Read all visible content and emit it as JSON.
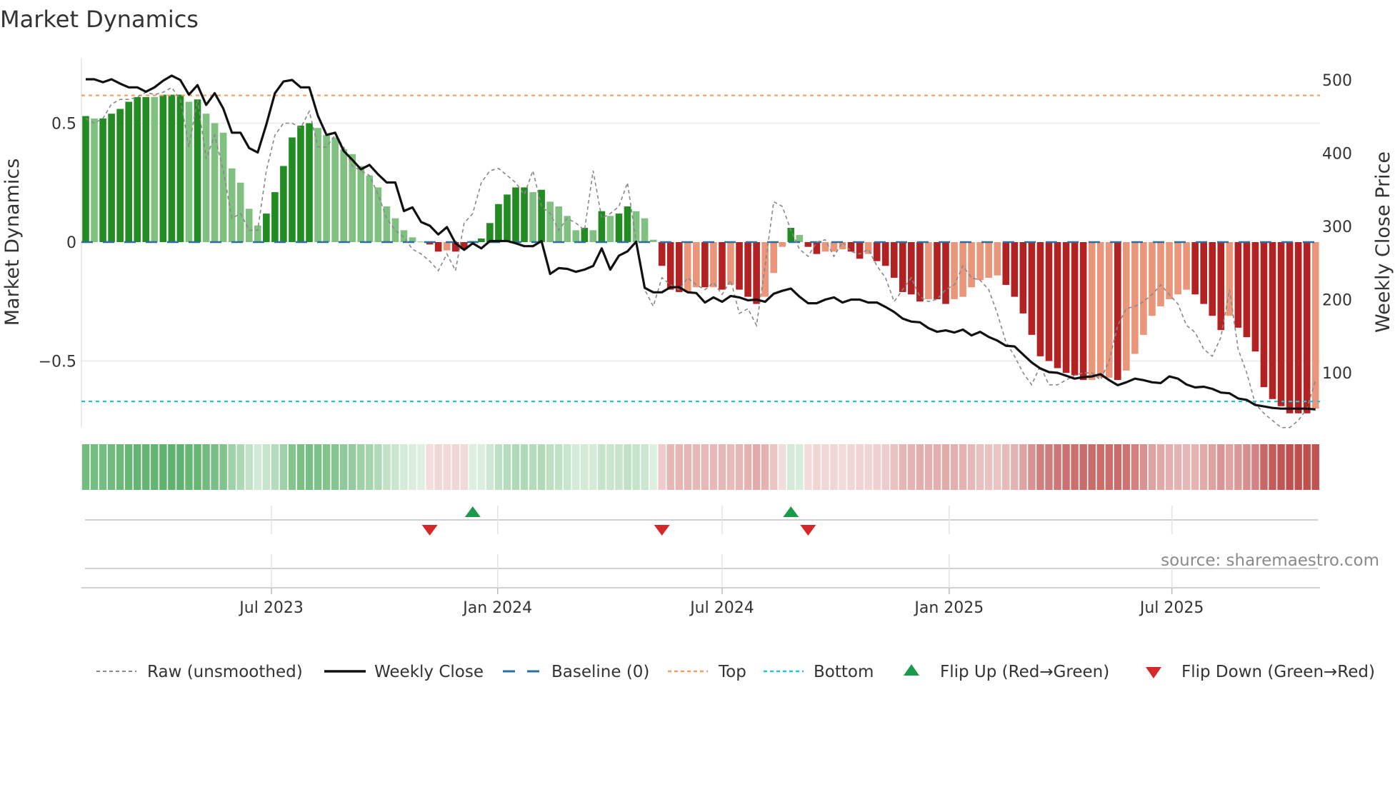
{
  "title": "Market Dynamics",
  "source": "source: sharemaestro.com",
  "chart_data": {
    "type": "bar",
    "title": "Market Dynamics",
    "xlabel": "",
    "ylabel": "Market Dynamics",
    "y2label": "Weekly Close Price",
    "ylim": [
      -0.778,
      0.775
    ],
    "y2lim": [
      26,
      530
    ],
    "y_ticks": [
      {
        "v": 0.5,
        "label": "0.5"
      },
      {
        "v": 0,
        "label": "0"
      },
      {
        "v": -0.5,
        "label": "−0.5"
      }
    ],
    "y2_ticks": [
      {
        "v": 500,
        "label": "500"
      },
      {
        "v": 400,
        "label": "400"
      },
      {
        "v": 300,
        "label": "300"
      },
      {
        "v": 200,
        "label": "200"
      },
      {
        "v": 100,
        "label": "100"
      }
    ],
    "x_unit": "week index (weekly bars)",
    "x_ticks": [
      {
        "week": 21.6,
        "label": "Jul 2023"
      },
      {
        "week": 47.9,
        "label": "Jan 2024"
      },
      {
        "week": 74.0,
        "label": "Jul 2024"
      },
      {
        "week": 100.4,
        "label": "Jan 2025"
      },
      {
        "week": 126.3,
        "label": "Jul 2025"
      }
    ],
    "grid": true,
    "legend_placement": "bottom",
    "thresholds": {
      "top": 0.617,
      "bottom": -0.67,
      "baseline": 0
    },
    "momentum": [
      0.53,
      0.52,
      0.52,
      0.54,
      0.56,
      0.59,
      0.61,
      0.61,
      0.61,
      0.62,
      0.62,
      0.62,
      0.59,
      0.6,
      0.54,
      0.5,
      0.46,
      0.31,
      0.25,
      0.14,
      0.07,
      0.12,
      0.21,
      0.32,
      0.44,
      0.49,
      0.5,
      0.48,
      0.45,
      0.44,
      0.39,
      0.37,
      0.32,
      0.28,
      0.23,
      0.15,
      0.1,
      0.05,
      0.02,
      0.002,
      -0.01,
      -0.04,
      -0.035,
      -0.04,
      -0.03,
      0.005,
      0.015,
      0.08,
      0.16,
      0.2,
      0.23,
      0.23,
      0.21,
      0.22,
      0.17,
      0.15,
      0.11,
      0.05,
      0.06,
      0.05,
      0.13,
      0.11,
      0.12,
      0.15,
      0.13,
      0.1,
      0.01,
      -0.1,
      -0.2,
      -0.21,
      -0.21,
      -0.19,
      -0.19,
      -0.19,
      -0.2,
      -0.18,
      -0.2,
      -0.23,
      -0.26,
      -0.23,
      -0.13,
      -0.02,
      0.06,
      0.03,
      -0.02,
      -0.05,
      -0.04,
      -0.04,
      -0.03,
      -0.04,
      -0.07,
      -0.05,
      -0.08,
      -0.1,
      -0.15,
      -0.21,
      -0.22,
      -0.25,
      -0.24,
      -0.24,
      -0.26,
      -0.24,
      -0.23,
      -0.19,
      -0.16,
      -0.15,
      -0.14,
      -0.18,
      -0.23,
      -0.3,
      -0.39,
      -0.48,
      -0.5,
      -0.53,
      -0.55,
      -0.56,
      -0.58,
      -0.58,
      -0.57,
      -0.57,
      -0.58,
      -0.54,
      -0.47,
      -0.39,
      -0.31,
      -0.27,
      -0.24,
      -0.22,
      -0.2,
      -0.22,
      -0.26,
      -0.31,
      -0.37,
      -0.31,
      -0.36,
      -0.4,
      -0.46,
      -0.61,
      -0.66,
      -0.69,
      -0.72,
      -0.72,
      -0.72,
      -0.7
    ],
    "strong": [
      1,
      0,
      1,
      1,
      1,
      1,
      1,
      1,
      0,
      1,
      1,
      1,
      0,
      1,
      0,
      0,
      0,
      0,
      0,
      0,
      0,
      1,
      1,
      1,
      1,
      1,
      1,
      0,
      0,
      0,
      0,
      0,
      0,
      0,
      0,
      0,
      0,
      0,
      0,
      0,
      1,
      1,
      0,
      1,
      1,
      0,
      1,
      1,
      1,
      1,
      1,
      1,
      0,
      1,
      0,
      0,
      0,
      0,
      1,
      0,
      1,
      0,
      1,
      1,
      0,
      0,
      0,
      1,
      1,
      1,
      0,
      0,
      1,
      0,
      1,
      0,
      1,
      1,
      1,
      0,
      0,
      0,
      1,
      0,
      1,
      1,
      0,
      0,
      0,
      1,
      1,
      0,
      1,
      1,
      1,
      1,
      1,
      1,
      0,
      1,
      1,
      0,
      0,
      0,
      0,
      0,
      0,
      1,
      1,
      1,
      1,
      1,
      1,
      1,
      1,
      1,
      1,
      0,
      0,
      0,
      1,
      0,
      0,
      0,
      0,
      0,
      0,
      0,
      0,
      1,
      1,
      1,
      1,
      0,
      1,
      1,
      1,
      1,
      1,
      1,
      1,
      1,
      1,
      0
    ],
    "raw": [
      0.52,
      0.5,
      0.52,
      0.58,
      0.6,
      0.6,
      0.61,
      0.63,
      0.62,
      0.63,
      0.65,
      0.6,
      0.4,
      0.6,
      0.35,
      0.45,
      0.3,
      0.1,
      0.12,
      0.05,
      0.05,
      0.3,
      0.45,
      0.5,
      0.5,
      0.48,
      0.55,
      0.4,
      0.4,
      0.45,
      0.4,
      0.32,
      0.3,
      0.28,
      0.2,
      0.1,
      0.05,
      0.02,
      -0.03,
      -0.05,
      -0.08,
      -0.12,
      -0.05,
      -0.12,
      0.08,
      0.12,
      0.25,
      0.3,
      0.31,
      0.28,
      0.25,
      0.2,
      0.3,
      0.15,
      0.12,
      0.05,
      0.1,
      0.08,
      0.05,
      0.3,
      0.1,
      0.12,
      0.15,
      0.25,
      0.0,
      -0.2,
      -0.27,
      -0.15,
      -0.18,
      -0.2,
      -0.15,
      -0.18,
      -0.2,
      -0.17,
      -0.22,
      -0.16,
      -0.3,
      -0.28,
      -0.35,
      -0.1,
      0.17,
      0.15,
      0.05,
      -0.03,
      -0.06,
      0.0,
      0.01,
      -0.06,
      0.0,
      -0.04,
      -0.05,
      -0.03,
      -0.1,
      -0.15,
      -0.25,
      -0.2,
      -0.15,
      -0.23,
      -0.25,
      -0.24,
      -0.2,
      -0.18,
      -0.1,
      -0.15,
      -0.16,
      -0.2,
      -0.3,
      -0.42,
      -0.48,
      -0.55,
      -0.6,
      -0.52,
      -0.6,
      -0.6,
      -0.58,
      -0.56,
      -0.55,
      -0.55,
      -0.58,
      -0.5,
      -0.35,
      -0.28,
      -0.27,
      -0.25,
      -0.22,
      -0.18,
      -0.22,
      -0.26,
      -0.35,
      -0.38,
      -0.45,
      -0.48,
      -0.4,
      -0.2,
      -0.45,
      -0.55,
      -0.68,
      -0.72,
      -0.75,
      -0.78,
      -0.78,
      -0.75,
      -0.7,
      -0.58
    ],
    "close": [
      501,
      501,
      497,
      501,
      495,
      490,
      490,
      484,
      490,
      499,
      506,
      500,
      480,
      493,
      466,
      482,
      461,
      428,
      428,
      407,
      401,
      439,
      482,
      498,
      500,
      490,
      490,
      451,
      425,
      428,
      403,
      391,
      378,
      384,
      371,
      360,
      360,
      321,
      326,
      306,
      301,
      289,
      299,
      277,
      268,
      277,
      270,
      280,
      280,
      280,
      277,
      273,
      273,
      280,
      235,
      243,
      242,
      238,
      241,
      246,
      270,
      241,
      260,
      266,
      279,
      216,
      210,
      210,
      217,
      217,
      210,
      209,
      196,
      203,
      197,
      205,
      203,
      199,
      200,
      197,
      208,
      212,
      215,
      204,
      195,
      195,
      200,
      203,
      196,
      200,
      200,
      196,
      196,
      190,
      183,
      174,
      170,
      169,
      161,
      156,
      158,
      155,
      159,
      151,
      156,
      149,
      144,
      137,
      136,
      125,
      114,
      106,
      101,
      100,
      96,
      92,
      94,
      95,
      98,
      90,
      83,
      87,
      92,
      90,
      87,
      86,
      95,
      92,
      84,
      80,
      81,
      78,
      73,
      72,
      65,
      63,
      56,
      54,
      52,
      51,
      51,
      51,
      51,
      50
    ],
    "flips": {
      "up": [
        45,
        82
      ],
      "down": [
        40,
        67,
        84
      ]
    },
    "colors": {
      "strong_green": "#228b22",
      "light_green": "#80c080",
      "strong_red": "#b22222",
      "light_red": "#e9967a",
      "baseline": "#2a6f9e",
      "top": "#f0a060",
      "bottom": "#22c3d6",
      "close": "#111111",
      "raw": "#888888",
      "flip_up": "#1a9a4a",
      "flip_down": "#d62728",
      "strip_green": "#4caa5c",
      "strip_red": "#c0504d"
    },
    "legend": [
      {
        "key": "raw",
        "label": "Raw (unsmoothed)"
      },
      {
        "key": "close",
        "label": "Weekly Close"
      },
      {
        "key": "baseline",
        "label": "Baseline (0)"
      },
      {
        "key": "top",
        "label": "Top"
      },
      {
        "key": "bottom",
        "label": "Bottom"
      },
      {
        "key": "flip_up",
        "label": "Flip Up (Red→Green)"
      },
      {
        "key": "flip_down",
        "label": "Flip Down (Green→Red)"
      }
    ]
  }
}
